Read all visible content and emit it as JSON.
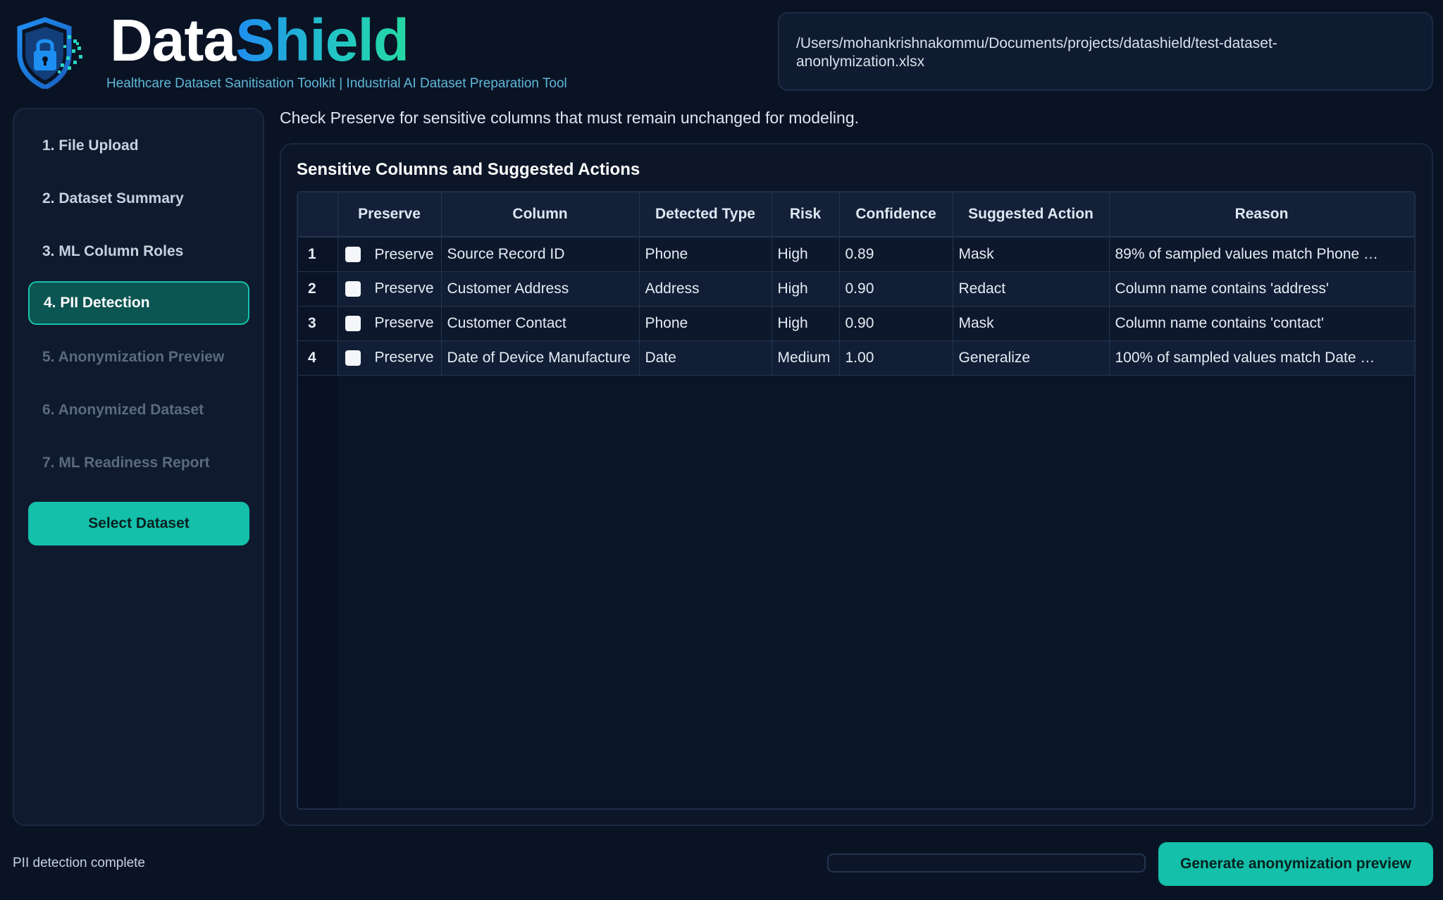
{
  "header": {
    "brand_part1": "Data",
    "brand_part2": "Shield",
    "tagline": "Healthcare Dataset Sanitisation Toolkit | Industrial AI Dataset Preparation Tool",
    "file_path_line1": "/Users/mohankrishnakommu/Documents/projects/datashield/test-dataset-",
    "file_path_line2": "anonlymization.xlsx"
  },
  "sidebar": {
    "items": [
      {
        "label": "1. File Upload",
        "state": "enabled"
      },
      {
        "label": "2. Dataset Summary",
        "state": "enabled"
      },
      {
        "label": "3. ML Column Roles",
        "state": "enabled"
      },
      {
        "label": "4. PII Detection",
        "state": "active"
      },
      {
        "label": "5. Anonymization Preview",
        "state": "disabled"
      },
      {
        "label": "6. Anonymized Dataset",
        "state": "disabled"
      },
      {
        "label": "7. ML Readiness Report",
        "state": "disabled"
      }
    ],
    "select_button": "Select Dataset"
  },
  "main": {
    "instruction": "Check Preserve for sensitive columns that must remain unchanged for modeling.",
    "panel_title": "Sensitive Columns and Suggested Actions",
    "table": {
      "headers": [
        "Preserve",
        "Column",
        "Detected Type",
        "Risk",
        "Confidence",
        "Suggested Action",
        "Reason"
      ],
      "rows": [
        {
          "index": "1",
          "preserve_label": "Preserve",
          "checked": false,
          "column": "Source Record ID",
          "type": "Phone",
          "risk": "High",
          "confidence": "0.89",
          "action": "Mask",
          "reason": "89% of sampled values match Phone …"
        },
        {
          "index": "2",
          "preserve_label": "Preserve",
          "checked": false,
          "column": "Customer Address",
          "type": "Address",
          "risk": "High",
          "confidence": "0.90",
          "action": "Redact",
          "reason": "Column name contains 'address'"
        },
        {
          "index": "3",
          "preserve_label": "Preserve",
          "checked": false,
          "column": "Customer Contact",
          "type": "Phone",
          "risk": "High",
          "confidence": "0.90",
          "action": "Mask",
          "reason": "Column name contains 'contact'"
        },
        {
          "index": "4",
          "preserve_label": "Preserve",
          "checked": false,
          "column": "Date of Device Manufacture",
          "type": "Date",
          "risk": "Medium",
          "confidence": "1.00",
          "action": "Generalize",
          "reason": "100% of sampled values match Date …"
        }
      ]
    }
  },
  "footer": {
    "status": "PII detection complete",
    "progress_fraction": 0,
    "generate_button": "Generate anonymization preview"
  },
  "colors": {
    "background": "#0a1324",
    "accent": "#14c0aa",
    "active_nav": "#0b5552",
    "brand_gradient_start": "#1f8cf0",
    "brand_gradient_end": "#25d8a3"
  },
  "icons": {
    "logo": "shield-lock-icon"
  }
}
